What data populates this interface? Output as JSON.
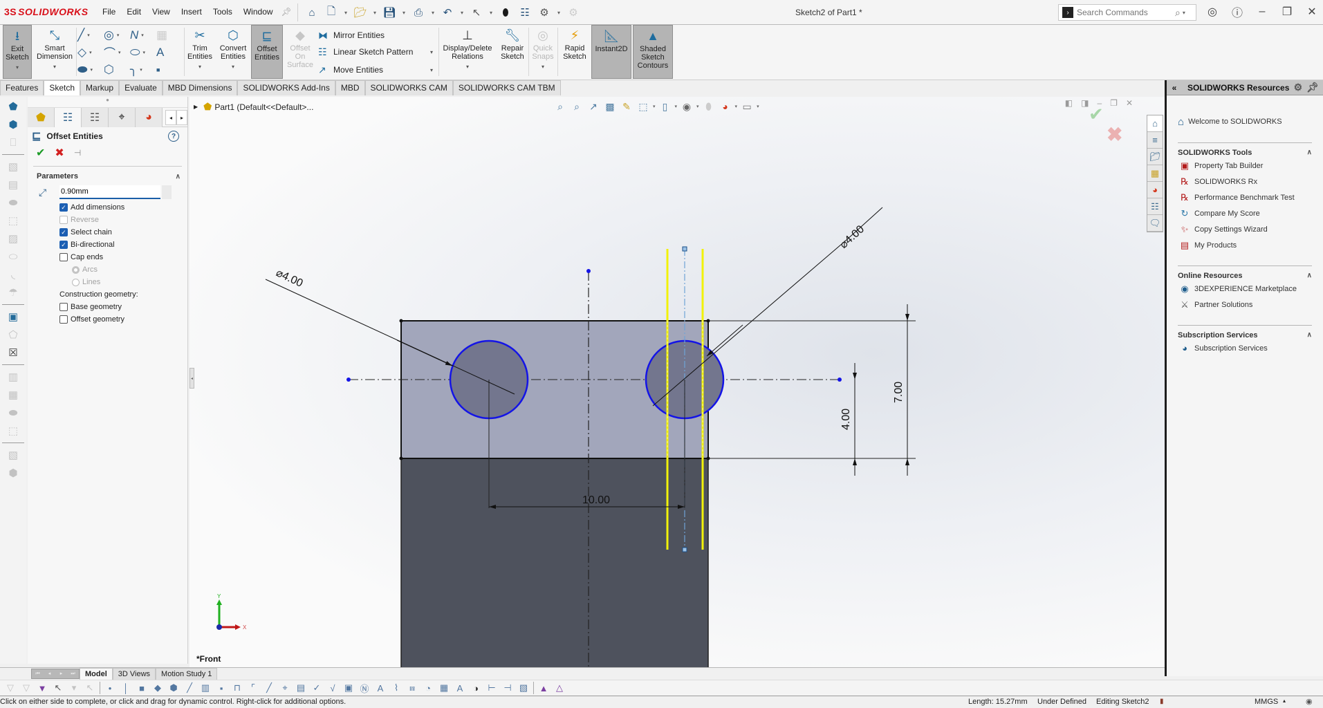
{
  "app": {
    "brand": "SOLIDWORKS",
    "brand_mark": "3S",
    "document_title": "Sketch2 of Part1 *",
    "menu": [
      "File",
      "Edit",
      "View",
      "Insert",
      "Tools",
      "Window"
    ],
    "search_placeholder": "Search Commands"
  },
  "commands": {
    "exit_sketch": "Exit\nSketch",
    "smart_dimension": "Smart\nDimension",
    "trim_entities": "Trim\nEntities",
    "convert_entities": "Convert\nEntities",
    "offset_entities": "Offset\nEntities",
    "offset_on_surface": "Offset\nOn\nSurface",
    "mirror_entities": "Mirror Entities",
    "linear_sketch_pattern": "Linear Sketch Pattern",
    "move_entities": "Move Entities",
    "display_delete_relations": "Display/Delete\nRelations",
    "repair_sketch": "Repair\nSketch",
    "quick_snaps": "Quick\nSnaps",
    "rapid_sketch": "Rapid\nSketch",
    "instant2d": "Instant2D",
    "shaded_sketch_contours": "Shaded\nSketch\nContours"
  },
  "tabs": [
    {
      "label": "Features",
      "active": false
    },
    {
      "label": "Sketch",
      "active": true
    },
    {
      "label": "Markup",
      "active": false
    },
    {
      "label": "Evaluate",
      "active": false
    },
    {
      "label": "MBD Dimensions",
      "active": false
    },
    {
      "label": "SOLIDWORKS Add-Ins",
      "active": false
    },
    {
      "label": "MBD",
      "active": false
    },
    {
      "label": "SOLIDWORKS CAM",
      "active": false
    },
    {
      "label": "SOLIDWORKS CAM TBM",
      "active": false
    }
  ],
  "property_manager": {
    "title": "Offset Entities",
    "help": "?",
    "section": "Parameters",
    "offset_value": "0.90mm",
    "options": [
      {
        "label": "Add dimensions",
        "checked": true,
        "enabled": true
      },
      {
        "label": "Reverse",
        "checked": false,
        "enabled": false
      },
      {
        "label": "Select chain",
        "checked": true,
        "enabled": true
      },
      {
        "label": "Bi-directional",
        "checked": true,
        "enabled": true
      },
      {
        "label": "Cap ends",
        "checked": false,
        "enabled": true
      }
    ],
    "cap_types": [
      {
        "label": "Arcs",
        "selected": true,
        "enabled": false
      },
      {
        "label": "Lines",
        "selected": false,
        "enabled": false
      }
    ],
    "construction_label": "Construction geometry:",
    "construction_options": [
      {
        "label": "Base geometry",
        "checked": false
      },
      {
        "label": "Offset geometry",
        "checked": false
      }
    ]
  },
  "viewport": {
    "tree_item": "Part1  (Default<<Default>...",
    "view_name": "*Front",
    "triad_x": "X",
    "triad_y": "Y",
    "dimensions": {
      "dia_left": "⌀4.00",
      "dia_right": "⌀4.00",
      "horizontal": "10.00",
      "vertical_small": "4.00",
      "vertical_large": "7.00"
    },
    "colors": {
      "sketch_circle": "#1414e6",
      "offset_lines": "#f2f20a",
      "fill_top": "#a2a6bb",
      "fill_bottom": "#4e525d",
      "dimension": "#111111"
    }
  },
  "resources": {
    "title": "SOLIDWORKS Resources",
    "welcome": "Welcome to SOLIDWORKS",
    "sections": [
      {
        "title": "SOLIDWORKS Tools",
        "items": [
          "Property Tab Builder",
          "SOLIDWORKS Rx",
          "Performance Benchmark Test",
          "Compare My Score",
          "Copy Settings Wizard",
          "My Products"
        ]
      },
      {
        "title": "Online Resources",
        "items": [
          "3DEXPERIENCE Marketplace",
          "Partner Solutions"
        ]
      },
      {
        "title": "Subscription Services",
        "items": [
          "Subscription Services"
        ]
      }
    ]
  },
  "bottom_tabs": [
    {
      "label": "Model",
      "active": true
    },
    {
      "label": "3D Views",
      "active": false
    },
    {
      "label": "Motion Study 1",
      "active": false
    }
  ],
  "status": {
    "message": "Click on either side to complete, or click and drag for dynamic control.  Right-click for additional options.",
    "length": "Length: 15.27mm",
    "defined": "Under Defined",
    "editing": "Editing Sketch2",
    "units": "MMGS"
  }
}
